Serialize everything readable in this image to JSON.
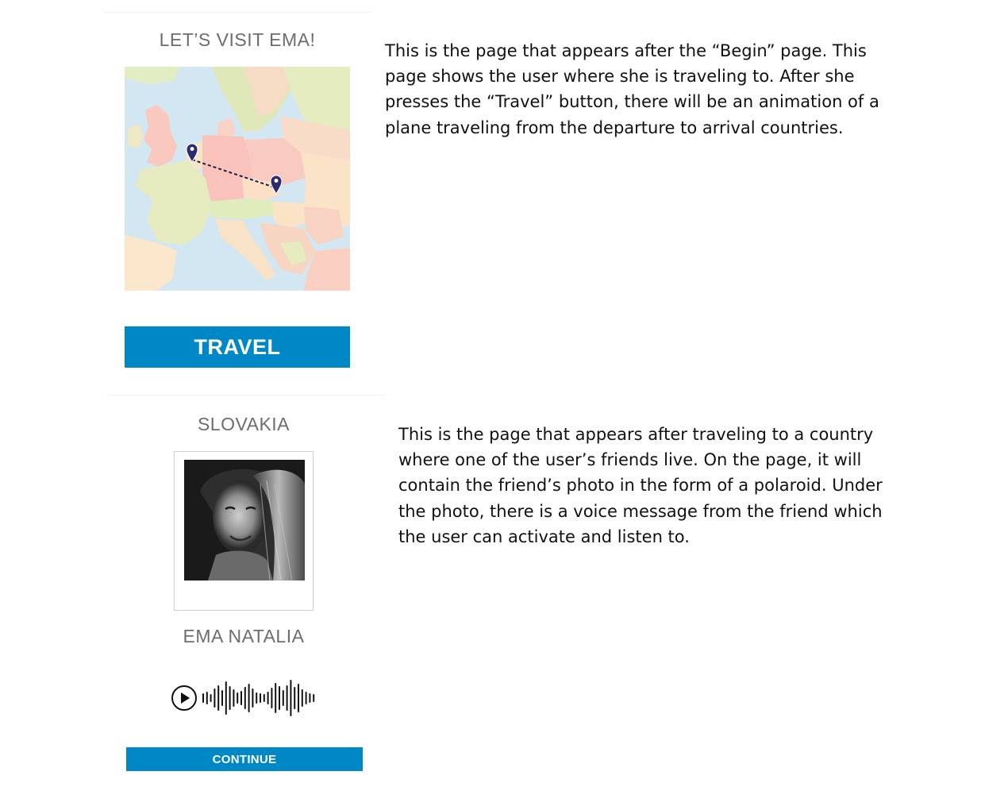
{
  "screen1": {
    "title": "LET’S VISIT EMA!",
    "map_icon": "europe-route-map",
    "button_label": "TRAVEL",
    "description": "This is the page that appears after the “Begin” page. This page shows the user where she is traveling to. After she presses the “Travel” button, there will be an animation of a plane traveling from the departure to arrival countries."
  },
  "screen2": {
    "title": "SLOVAKIA",
    "photo_icon": "friend-portrait-photo",
    "friend_name": "EMA NATALIA",
    "play_icon": "play-icon",
    "waveform_icon": "waveform-icon",
    "button_label": "CONTINUE",
    "description": "This is the page that appears after traveling to a country where one of the user’s friends live. On the page, it will contain the friend’s photo in the form of a polaroid. Under the photo, there is a voice message from the friend which the user can activate and listen to."
  },
  "colors": {
    "accent": "#0088c6",
    "title_text": "#6d6d6d",
    "map_water": "#d4e8f3",
    "map_pin": "#2a2c6e"
  }
}
